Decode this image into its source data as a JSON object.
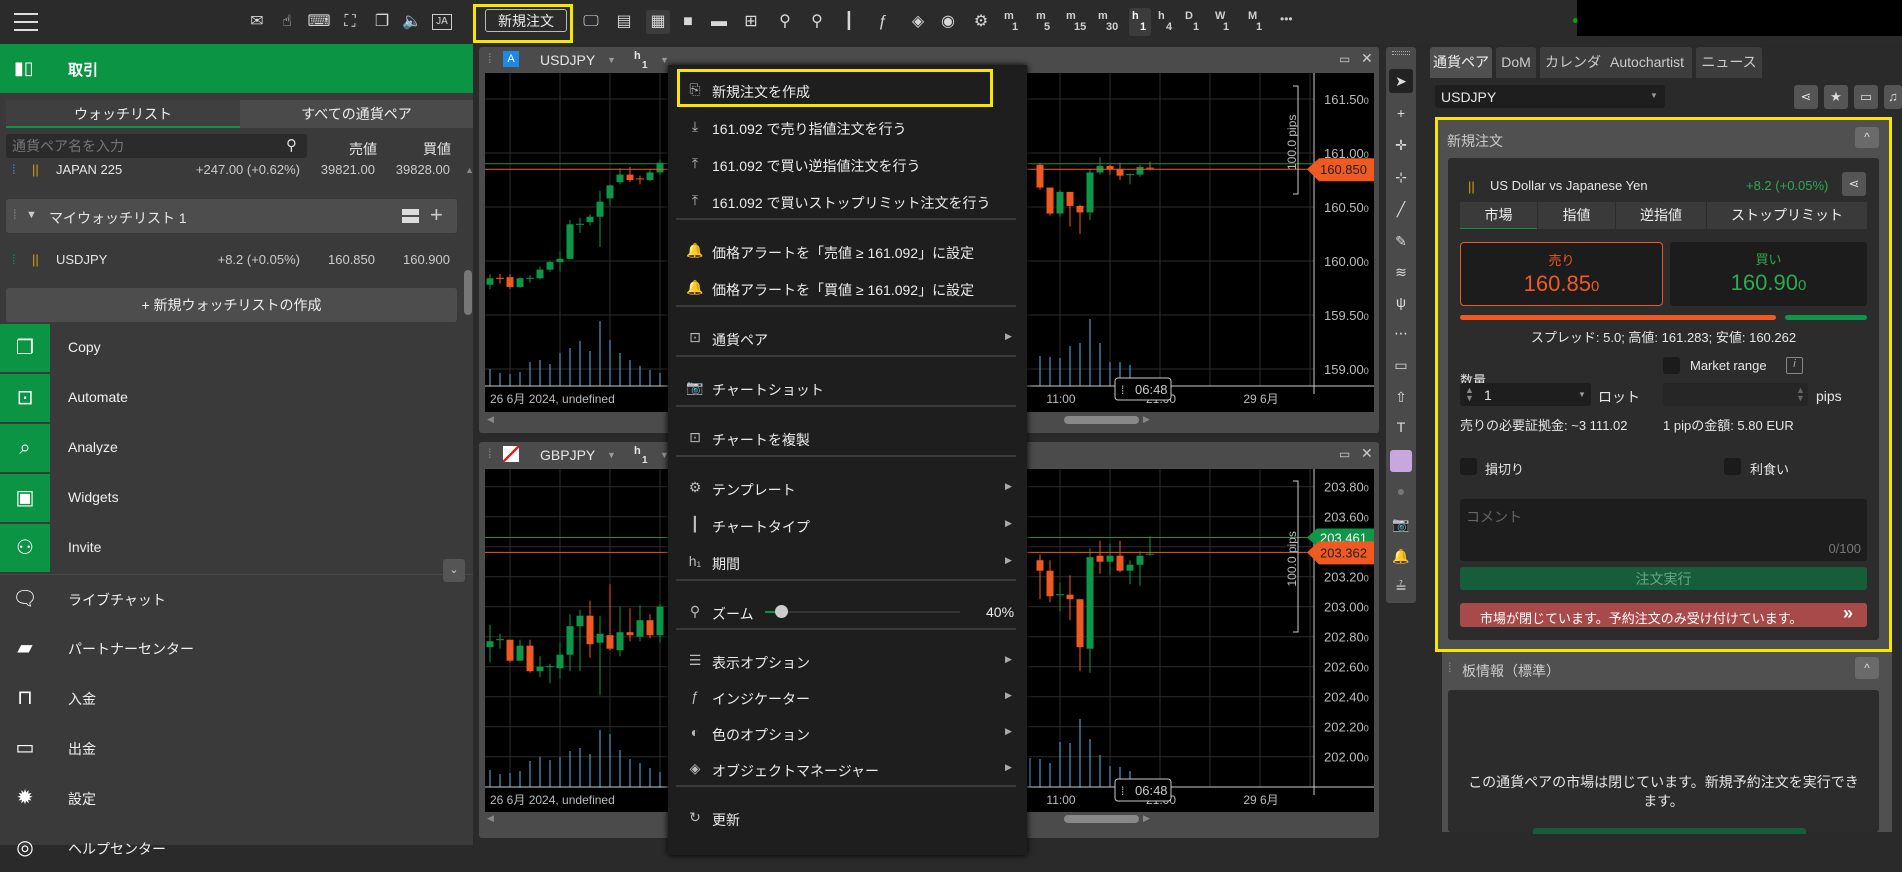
{
  "toolbar": {
    "new_order_label": "新規注文",
    "icons": [
      "mail-icon",
      "touch-settings-icon",
      "keyboard-icon",
      "fullscreen-icon",
      "copy-window-icon",
      "sound-icon",
      "language-ja-icon",
      "chart-monitor-icon",
      "layout-panel-icon",
      "grid-4-icon",
      "single-layout-icon",
      "split-layout-icon",
      "add-chart-icon",
      "zoom-out-icon",
      "zoom-in-icon",
      "candles-icon",
      "indicator-icon",
      "layers-icon",
      "eye-icon",
      "template-icon"
    ],
    "timeframes": [
      {
        "a": "m",
        "b": "1"
      },
      {
        "a": "m",
        "b": "5"
      },
      {
        "a": "m",
        "b": "15"
      },
      {
        "a": "m",
        "b": "30"
      },
      {
        "a": "h",
        "b": "1",
        "active": true
      },
      {
        "a": "h",
        "b": "4"
      },
      {
        "a": "D",
        "b": "1"
      },
      {
        "a": "W",
        "b": "1"
      },
      {
        "a": "M",
        "b": "1"
      }
    ],
    "more": "•••"
  },
  "left": {
    "trade": "取引",
    "tabs": [
      "ウォッチリスト",
      "すべての通貨ペア"
    ],
    "search_placeholder": "通貨ペア名を入力",
    "col_sell": "売値",
    "col_buy": "買値",
    "rows": [
      {
        "name": "JAPAN 225",
        "change": "+247.00 (+0.62%)",
        "sell": "39821.00",
        "buy": "39828.00"
      }
    ],
    "watchlist_name": "マイウォッチリスト 1",
    "watch_rows": [
      {
        "name": "USDJPY",
        "change": "+8.2 (+0.05%)",
        "sell": "160.850",
        "buy": "160.900"
      }
    ],
    "new_watchlist": "+ 新規ウォッチリストの作成",
    "menu": [
      {
        "label": "Copy",
        "icon": "copy-icon",
        "green": true
      },
      {
        "label": "Automate",
        "icon": "robot-icon",
        "green": true
      },
      {
        "label": "Analyze",
        "icon": "analyze-icon",
        "green": true
      },
      {
        "label": "Widgets",
        "icon": "widgets-icon",
        "green": true
      },
      {
        "label": "Invite",
        "icon": "invite-icon",
        "green": true
      },
      {
        "label": "ライブチャット",
        "icon": "chat-icon"
      },
      {
        "label": "パートナーセンター",
        "icon": "briefcase-icon"
      },
      {
        "label": "入金",
        "icon": "deposit-icon"
      },
      {
        "label": "出金",
        "icon": "withdraw-icon"
      },
      {
        "label": "設定",
        "icon": "gear-icon"
      },
      {
        "label": "ヘルプセンター",
        "icon": "help-icon"
      }
    ]
  },
  "charts": [
    {
      "symbol": "USDJPY",
      "badge": "A",
      "period_a": "h",
      "period_b": "1",
      "date_label": "26 6月 2024, undefined",
      "time_labels": [
        "11:00",
        "21:00",
        "29 6月"
      ],
      "cursor_time": "06:48",
      "range_label": "100.0 pips",
      "price_ticks": [
        161.5,
        161.0,
        160.5,
        160.0,
        159.5,
        159.0
      ],
      "ask": 160.9,
      "bid": 160.85,
      "bid_label": "160.850",
      "ask_label": "",
      "up_color": "#0e9748",
      "down_color": "#f05a22",
      "candles_left": [
        [
          159.78,
          159.84,
          159.88,
          159.74
        ],
        [
          159.84,
          159.83,
          159.88,
          159.79
        ],
        [
          159.85,
          159.76,
          159.88,
          159.74
        ],
        [
          159.76,
          159.84,
          159.85,
          159.75
        ],
        [
          159.83,
          159.84,
          159.87,
          159.8
        ],
        [
          159.84,
          159.92,
          159.95,
          159.83
        ],
        [
          159.92,
          159.99,
          160.0,
          159.9
        ],
        [
          159.99,
          160.02,
          160.09,
          159.9
        ],
        [
          160.02,
          160.34,
          160.38,
          160.02
        ],
        [
          160.33,
          160.34,
          160.4,
          160.26
        ],
        [
          160.36,
          160.41,
          160.43,
          160.33
        ],
        [
          160.41,
          160.55,
          160.65,
          160.13
        ],
        [
          160.58,
          160.7,
          160.71,
          160.51
        ],
        [
          160.73,
          160.8,
          160.86,
          160.71
        ],
        [
          160.8,
          160.75,
          160.87,
          160.73
        ],
        [
          160.76,
          160.75,
          160.79,
          160.71
        ],
        [
          160.75,
          160.82,
          160.85,
          160.74
        ],
        [
          160.82,
          160.91,
          160.94,
          160.8
        ]
      ],
      "candles_right": [
        [
          160.89,
          160.68,
          160.91,
          160.66
        ],
        [
          160.68,
          160.44,
          160.68,
          160.42
        ],
        [
          160.44,
          160.64,
          160.66,
          160.41
        ],
        [
          160.64,
          160.51,
          160.64,
          160.32
        ],
        [
          160.51,
          160.45,
          160.52,
          160.25
        ],
        [
          160.45,
          160.82,
          160.85,
          160.38
        ],
        [
          160.82,
          160.88,
          160.96,
          160.8
        ],
        [
          160.88,
          160.85,
          160.89,
          160.8
        ],
        [
          160.85,
          160.79,
          160.91,
          160.75
        ],
        [
          160.79,
          160.8,
          160.81,
          160.71
        ],
        [
          160.8,
          160.87,
          160.89,
          160.78
        ],
        [
          160.86,
          160.85,
          160.92,
          160.84
        ]
      ],
      "volume_left": [
        17,
        13,
        12,
        14,
        24,
        26,
        22,
        33,
        38,
        45,
        35,
        65,
        46,
        33,
        26,
        20,
        16,
        13
      ],
      "volume_right": [
        30,
        29,
        28,
        40,
        43,
        67,
        43,
        24,
        24,
        21
      ]
    },
    {
      "symbol": "GBPJPY",
      "badge": "",
      "period_a": "h",
      "period_b": "1",
      "date_label": "26 6月 2024, undefined",
      "time_labels": [
        "11:00",
        "21:00",
        "29 6月"
      ],
      "cursor_time": "06:48",
      "range_label": "100.0 pips",
      "price_ticks": [
        203.8,
        203.6,
        203.4,
        203.2,
        203.0,
        202.8,
        202.6,
        202.4,
        202.2,
        202.0
      ],
      "ask": 203.461,
      "bid": 203.362,
      "ask_label": "203.461",
      "bid_label": "203.362",
      "up_color": "#0e9748",
      "down_color": "#f05a22",
      "candles_left": [
        [
          202.73,
          202.77,
          202.88,
          202.63
        ],
        [
          202.78,
          202.78,
          202.82,
          202.72
        ],
        [
          202.78,
          202.64,
          202.78,
          202.63
        ],
        [
          202.64,
          202.74,
          202.78,
          202.64
        ],
        [
          202.74,
          202.57,
          202.78,
          202.56
        ],
        [
          202.57,
          202.6,
          202.67,
          202.53
        ],
        [
          202.6,
          202.6,
          202.62,
          202.49
        ],
        [
          202.59,
          202.68,
          202.76,
          202.52
        ],
        [
          202.68,
          202.87,
          202.95,
          202.57
        ],
        [
          202.87,
          202.94,
          202.98,
          202.57
        ],
        [
          202.94,
          202.75,
          203.04,
          202.66
        ],
        [
          202.76,
          202.82,
          202.94,
          202.41
        ],
        [
          202.81,
          202.72,
          203.15,
          202.71
        ],
        [
          202.71,
          202.83,
          203.0,
          202.67
        ],
        [
          202.83,
          202.81,
          202.99,
          202.77
        ],
        [
          202.8,
          202.91,
          203.01,
          202.77
        ],
        [
          202.91,
          202.81,
          202.95,
          202.79
        ],
        [
          202.81,
          203.0,
          203.02,
          202.76
        ]
      ],
      "candles_right": [
        [
          203.31,
          203.24,
          203.35,
          203.05
        ],
        [
          203.24,
          203.07,
          203.31,
          203.03
        ],
        [
          203.07,
          203.08,
          203.16,
          202.97
        ],
        [
          203.08,
          203.05,
          203.21,
          202.91
        ],
        [
          203.05,
          202.73,
          203.05,
          202.57
        ],
        [
          202.72,
          203.33,
          203.39,
          202.56
        ],
        [
          203.34,
          203.3,
          203.44,
          203.22
        ],
        [
          203.3,
          203.34,
          203.42,
          203.21
        ],
        [
          203.34,
          203.24,
          203.44,
          203.23
        ],
        [
          203.24,
          203.28,
          203.31,
          203.15
        ],
        [
          203.28,
          203.34,
          203.37,
          203.14
        ],
        [
          203.35,
          203.35,
          203.47,
          203.34
        ]
      ],
      "volume_left": [
        17,
        13,
        14,
        16,
        26,
        30,
        27,
        30,
        36,
        39,
        33,
        57,
        53,
        37,
        28,
        24,
        19,
        15
      ],
      "volume_right": [
        29,
        28,
        24,
        45,
        44,
        68,
        48,
        32,
        21,
        20,
        16
      ]
    }
  ],
  "context_menu": {
    "items": [
      {
        "label": "新規注文を作成",
        "icon": "new-order-icon",
        "highlight": true
      },
      {
        "label": "161.092 で売り指値注文を行う",
        "icon": "sell-limit-icon"
      },
      {
        "label": "161.092 で買い逆指値注文を行う",
        "icon": "buy-stop-icon"
      },
      {
        "label": "161.092 で買いストップリミット注文を行う",
        "icon": "buy-stop-limit-icon",
        "sep": true
      },
      {
        "label": "価格アラートを「売値 ≥ 161.092」に設定",
        "icon": "bell-icon"
      },
      {
        "label": "価格アラートを「買値 ≥ 161.092」に設定",
        "icon": "bell-icon",
        "sep": true
      },
      {
        "label": "通貨ペア",
        "icon": "chart-icon",
        "sub": true,
        "sep": true
      },
      {
        "label": "チャートショット",
        "icon": "camera-icon",
        "sep": true
      },
      {
        "label": "チャートを複製",
        "icon": "duplicate-chart-icon",
        "sep": true
      },
      {
        "label": "テンプレート",
        "icon": "template-icon",
        "sub": true
      },
      {
        "label": "チャートタイプ",
        "icon": "candles-icon",
        "sub": true
      },
      {
        "label": "期間",
        "icon": "period-icon",
        "sub": true,
        "sep": true
      },
      {
        "label": "ズーム",
        "icon": "zoom-icon",
        "zoom": true,
        "sep": true
      },
      {
        "label": "表示オプション",
        "icon": "checklist-icon",
        "sub": true
      },
      {
        "label": "インジケーター",
        "icon": "indicator-icon",
        "sub": true
      },
      {
        "label": "色のオプション",
        "icon": "palette-icon",
        "sub": true
      },
      {
        "label": "オブジェクトマネージャー",
        "icon": "layers-icon",
        "sub": true,
        "sep": true
      },
      {
        "label": "更新",
        "icon": "refresh-icon"
      }
    ],
    "zoom_value": "40%",
    "zoom_percent": 40
  },
  "drawing_tools": [
    "cursor-icon",
    "crosshair-icon",
    "crosshair-magnet-icon",
    "point-icon",
    "line-icon",
    "pen-icon",
    "fib-icon",
    "pitchfork-icon",
    "fib-grid-icon",
    "rectangle-icon",
    "arrow-icon",
    "text-icon",
    "color-swatch-icon",
    "dot-icon",
    "camera-icon",
    "bell-icon",
    "order-line-icon"
  ],
  "drawing_color": "#c7a7e0",
  "right": {
    "tabs": [
      "通貨ペア",
      "DoM",
      "カレンダー",
      "Autochartist",
      "ニュース"
    ],
    "symbol": "USDJPY",
    "order": {
      "title": "新規注文",
      "pair": "US Dollar vs Japanese Yen",
      "change": "+8.2 (+0.05%)",
      "types": [
        "市場",
        "指値",
        "逆指値",
        "ストップリミット"
      ],
      "sell_label": "売り",
      "sell_price": "160.85",
      "sell_pip": "0",
      "buy_label": "買い",
      "buy_price": "160.90",
      "buy_pip": "0",
      "sell_share": 79,
      "spread": "スプレッド: 5.0; 高値: 161.283; 安値: 160.262",
      "qty_label": "数量",
      "qty": "1",
      "lot": "ロット",
      "market_range": "Market range",
      "pips": "pips",
      "margin": "売りの必要証拠金: ~3 111.02",
      "pip_value": "1 pipの金額: 5.80 EUR",
      "stop_loss": "損切り",
      "take_profit": "利食い",
      "comment_placeholder": "コメント",
      "comment_count": "0/100",
      "submit": "注文実行",
      "closed_banner": "市場が閉じています。予約注文のみ受け付けています。",
      "banner_arrow": "»"
    },
    "depth": {
      "title": "板情報（標準）",
      "message": "この通貨ペアの市場は閉じています。新規予約注文を実行できます。"
    }
  }
}
